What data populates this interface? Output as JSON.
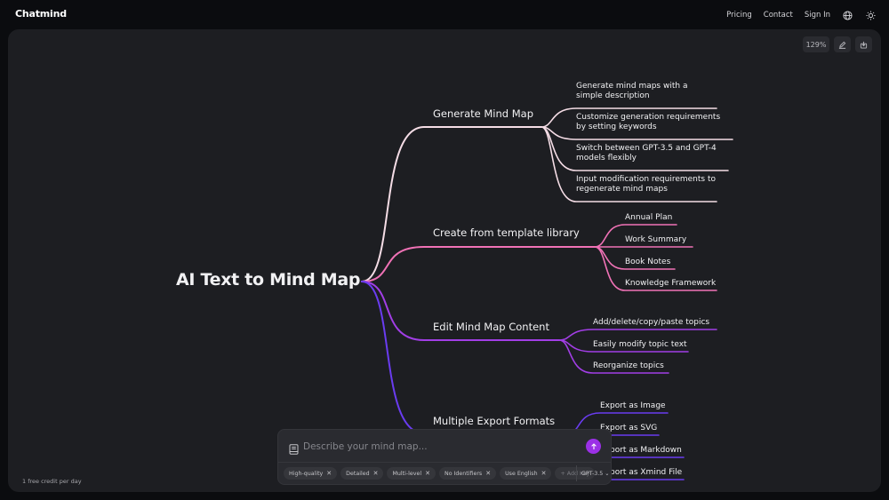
{
  "header": {
    "logo": "Chatmind",
    "nav": [
      "Pricing",
      "Contact",
      "Sign In"
    ],
    "icons": [
      "globe-icon",
      "sun-icon"
    ]
  },
  "toolbar": {
    "zoom_level": "129%",
    "icons": [
      "edit-icon",
      "download-icon"
    ]
  },
  "mindmap": {
    "root": "AI Text to Mind Map",
    "branches": [
      {
        "label": "Generate Mind Map",
        "color": "#f5dde6",
        "children": [
          "Generate mind maps with a simple description",
          "Customize generation requirements by setting keywords",
          "Switch between GPT-3.5 and GPT-4 models flexibly",
          "Input modification requirements to regenerate mind maps"
        ]
      },
      {
        "label": "Create from template library",
        "color": "#f072b6",
        "children": [
          "Annual Plan",
          "Work Summary",
          "Book Notes",
          "Knowledge Framework"
        ]
      },
      {
        "label": "Edit Mind Map Content",
        "color": "#a23ee6",
        "children": [
          "Add/delete/copy/paste topics",
          "Easily modify topic text",
          "Reorganize topics"
        ]
      },
      {
        "label": "Multiple Export Formats",
        "color": "#6a3cf0",
        "children": [
          "Export as Image",
          "Export as SVG",
          "Export as Markdown",
          "Export as Xmind File"
        ]
      }
    ]
  },
  "composer": {
    "placeholder": "Describe your mind map...",
    "value": "",
    "tags": [
      "High-quality",
      "Detailed",
      "Multi-level",
      "No Identifiers",
      "Use English"
    ],
    "add_keyword": "+ Add Key",
    "model": "GPT-3.5",
    "send_color": "#9b30e6"
  },
  "footer": {
    "credit": "1 free credit per day"
  }
}
